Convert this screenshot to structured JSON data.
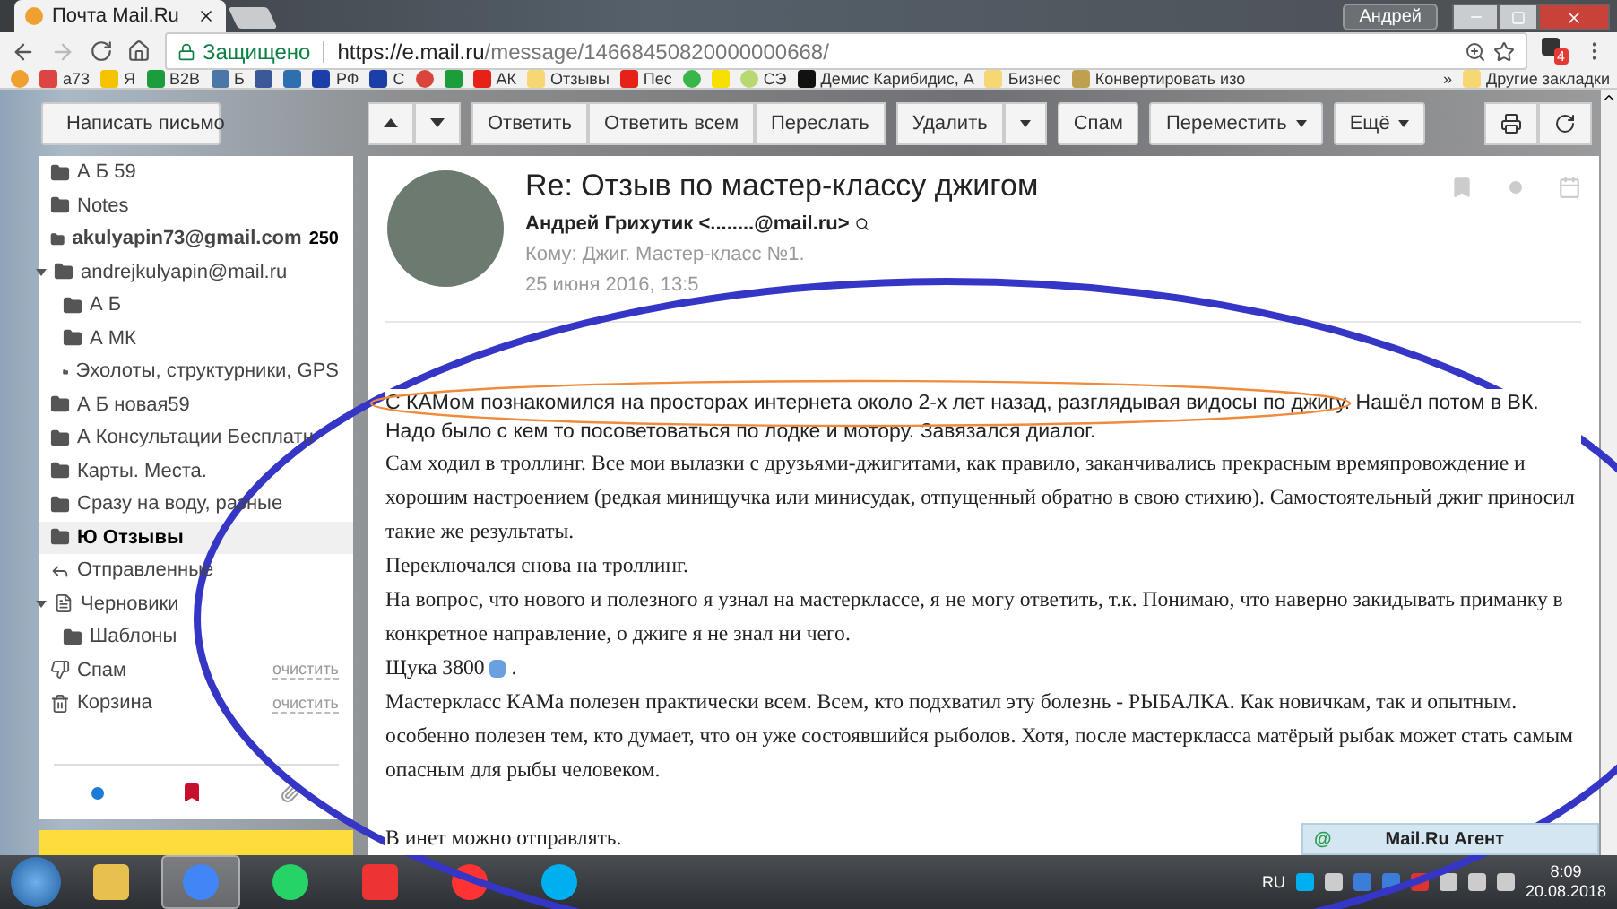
{
  "browser": {
    "tab_title": "Почта Mail.Ru",
    "profile": "Андрей",
    "secure_label": "Защищено",
    "url_host": "https://e.mail.ru",
    "url_path": "/message/14668450820000000668/",
    "extension_badge": "4"
  },
  "bookmarks": [
    {
      "kind": "mailru"
    },
    {
      "kind": "gmail",
      "label": "a73"
    },
    {
      "kind": "ymail",
      "label": "Я"
    },
    {
      "kind": "tt",
      "label": "B2B"
    },
    {
      "kind": "vk",
      "label": "Б"
    },
    {
      "kind": "fb"
    },
    {
      "kind": "pen"
    },
    {
      "kind": "rf",
      "label": "РФ"
    },
    {
      "kind": "rf",
      "label": "С"
    },
    {
      "kind": "gplus"
    },
    {
      "kind": "tt"
    },
    {
      "kind": "youtube",
      "label": "АК"
    },
    {
      "kind": "folder",
      "label": "Отзывы"
    },
    {
      "kind": "youtube",
      "label": "Пес"
    },
    {
      "kind": "check"
    },
    {
      "kind": "yblock"
    },
    {
      "kind": "link",
      "label": "СЭ"
    },
    {
      "kind": "play",
      "label": "Демис Карибидис, А"
    },
    {
      "kind": "folder",
      "label": "Бизнес"
    },
    {
      "kind": "conv",
      "label": "Конвертировать изо"
    }
  ],
  "bookmarks_more": "»",
  "other_bookmarks": "Другие закладки",
  "compose_button": "Написать письмо",
  "toolbar": [
    {
      "label": "Ответить",
      "kind": "plain"
    },
    {
      "label": "Ответить всем",
      "kind": "plain"
    },
    {
      "label": "Переслать",
      "kind": "plain"
    },
    {
      "label": "Удалить",
      "kind": "split"
    },
    {
      "label": "Спам",
      "kind": "plain"
    },
    {
      "label": "Переместить",
      "kind": "menu"
    },
    {
      "label": "Ещё",
      "kind": "menu"
    }
  ],
  "sidebar": {
    "items": [
      {
        "label": "А Б 59",
        "kind": "folder",
        "selected": false
      },
      {
        "label": "Notes",
        "kind": "folder",
        "selected": false
      },
      {
        "label": "akulyapin73@gmail.com",
        "kind": "folder",
        "selected": false,
        "count": "250"
      },
      {
        "label": "andrejkulyapin@mail.ru",
        "kind": "folder",
        "selected": false,
        "expanded": true,
        "children": [
          {
            "label": "А Б",
            "kind": "folder",
            "selected": false
          },
          {
            "label": "А МК",
            "kind": "folder",
            "selected": false
          },
          {
            "label": "Эхолоты, структурники, GPS",
            "kind": "folder",
            "selected": false
          }
        ]
      },
      {
        "label": "А Б новая59",
        "kind": "folder",
        "selected": false
      },
      {
        "label": "А Консультации Бесплатн",
        "kind": "folder",
        "selected": false
      },
      {
        "label": "Карты. Места.",
        "kind": "folder",
        "selected": false
      },
      {
        "label": "Сразу на воду, разные",
        "kind": "folder",
        "selected": false
      },
      {
        "label": "Ю Отзывы",
        "kind": "folder",
        "selected": true
      },
      {
        "label": "Отправленные",
        "kind": "sent",
        "selected": false
      },
      {
        "label": "Черновики",
        "kind": "drafts",
        "selected": false,
        "expanded": true,
        "children": [
          {
            "label": "Шаблоны",
            "kind": "folder",
            "selected": false
          }
        ]
      },
      {
        "label": "Спам",
        "kind": "spam",
        "selected": false,
        "action": "очистить"
      },
      {
        "label": "Корзина",
        "kind": "trash",
        "selected": false,
        "action": "очистить"
      }
    ]
  },
  "message": {
    "subject": "Re: Отзыв по мастер-классу джигом",
    "sender": "Андрей Грихутик <........@mail.ru>",
    "recipients": "Кому: Джиг. Мастер-класс №1.",
    "date": "25 июня 2016, 13:5",
    "paragraphs": [
      {
        "kind": "sans",
        "text": "С КАМом познакомился на просторах интернета около 2-х лет назад, разглядывая видосы по джигу. Нашёл потом в ВК. Надо было с кем то посоветоваться по лодке и мотору. Завязался диалог."
      },
      {
        "kind": "serif",
        "text": "Сам ходил в троллинг. Все мои вылазки с друзьями-джигитами, как правило, заканчивались прекрасным времяпровождение и хорошим настроением (редкая минищучка или минисудак, отпущенный обратно в свою стихию). Самостоятельный джиг приносил такие же результаты."
      },
      {
        "kind": "serif",
        "text": "Переключался снова на троллинг."
      },
      {
        "kind": "serif",
        "text": "На вопрос, что нового и полезного я узнал на мастерклассе, я не могу ответить, т.к. Понимаю, что наверно закидывать приманку в конкретное направление, о джиге я не знал ни чего."
      },
      {
        "kind": "serif",
        "text": "Щука 3800",
        "after_icon": "."
      },
      {
        "kind": "serif",
        "text": "Мастеркласс КАМа полезен практически всем. Всем, кто подхватил эту болезнь - РЫБАЛКА. Как новичкам, так и опытным. особенно полезен тем, кто думает, что он уже состоявшийся рыболов. Хотя, после мастеркласса матёрый рыбак может стать самым опасным для рыбы человеком."
      },
      {
        "kind": "serif",
        "text": "В инет можно отправлять.",
        "spaced": true
      }
    ]
  },
  "agent": {
    "logo": "@",
    "title": "Mail.Ru Агент"
  },
  "taskbar": {
    "apps": [
      {
        "kind": "explorer",
        "selected": false
      },
      {
        "kind": "chrome",
        "selected": true
      },
      {
        "kind": "whatsapp",
        "selected": false
      },
      {
        "kind": "yandex",
        "selected": false
      },
      {
        "kind": "ybrowser",
        "selected": false
      },
      {
        "kind": "skype",
        "selected": false
      }
    ],
    "language": "RU",
    "time": "8:09",
    "date": "20.08.2018"
  }
}
